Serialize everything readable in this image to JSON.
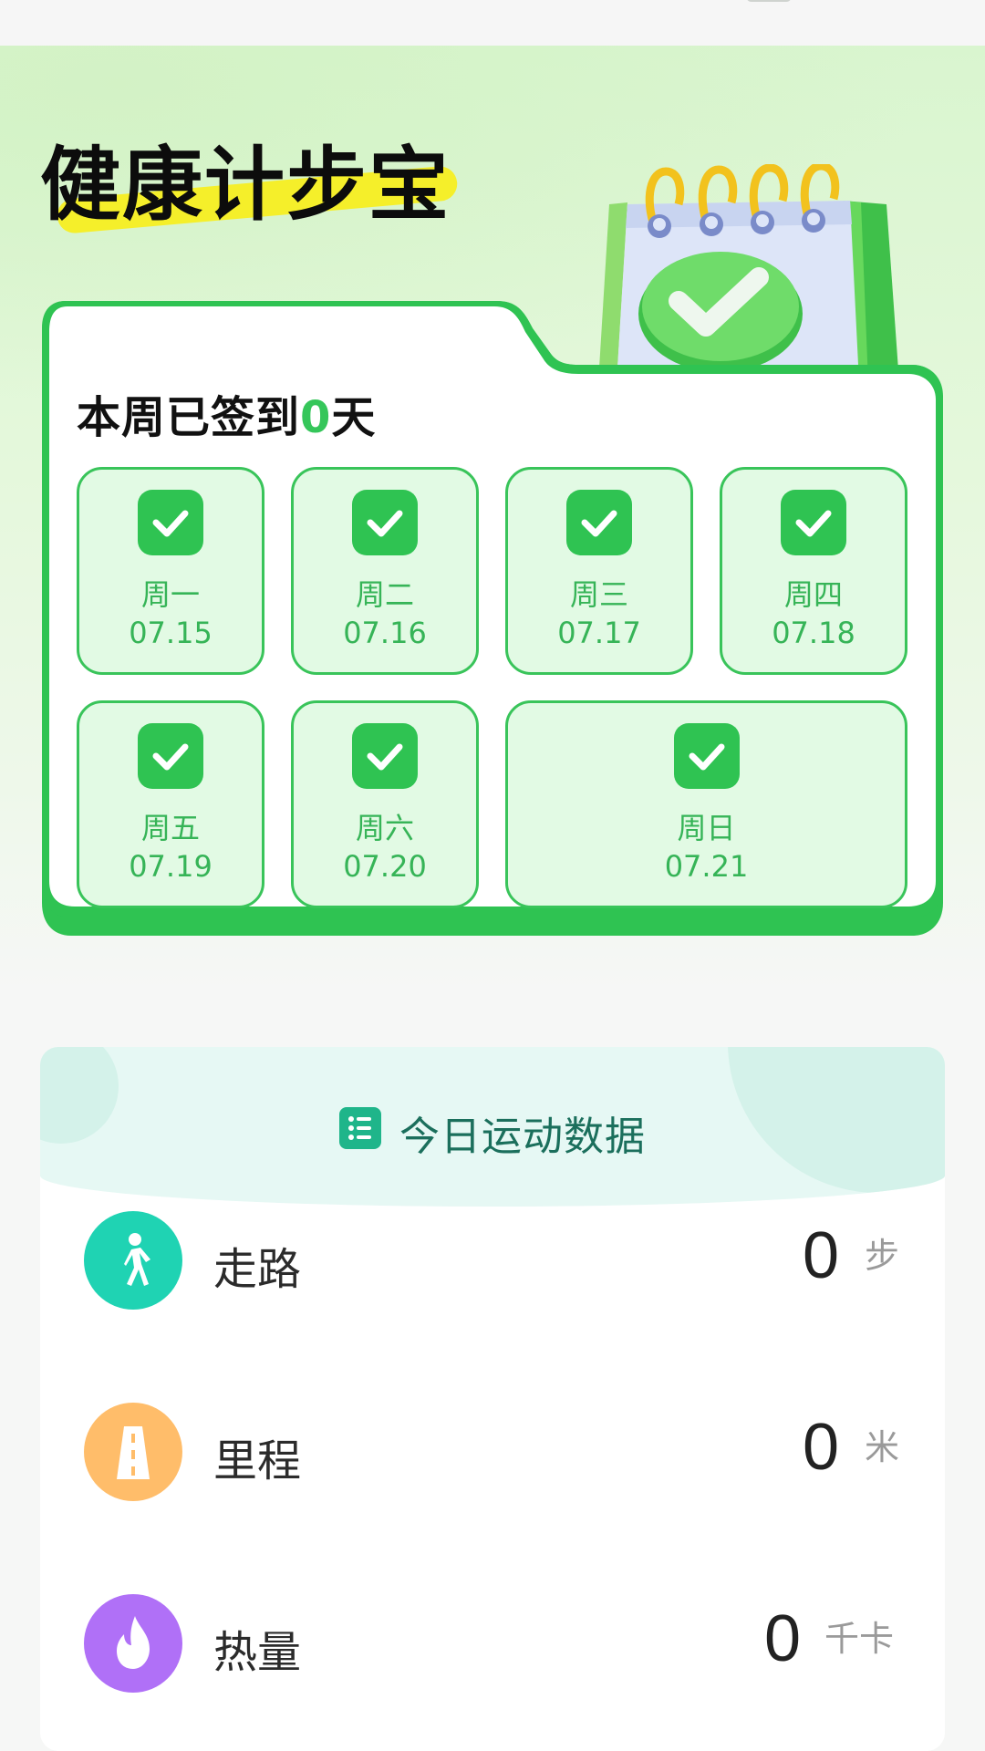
{
  "app": {
    "title": "健康计步宝"
  },
  "checkin": {
    "title_prefix": "本周已签到",
    "count": "0",
    "title_suffix": "天",
    "days": [
      {
        "name": "周一",
        "date": "07.15",
        "checked": true
      },
      {
        "name": "周二",
        "date": "07.16",
        "checked": true
      },
      {
        "name": "周三",
        "date": "07.17",
        "checked": true
      },
      {
        "name": "周四",
        "date": "07.18",
        "checked": true
      },
      {
        "name": "周五",
        "date": "07.19",
        "checked": true
      },
      {
        "name": "周六",
        "date": "07.20",
        "checked": true
      },
      {
        "name": "周日",
        "date": "07.21",
        "checked": true
      }
    ]
  },
  "today": {
    "title": "今日运动数据",
    "metrics": [
      {
        "label": "走路",
        "value": "0",
        "unit": "步",
        "icon": "walk-icon",
        "color": "#1fd3b3"
      },
      {
        "label": "里程",
        "value": "0",
        "unit": "米",
        "icon": "road-icon",
        "color": "#ffbd6a"
      },
      {
        "label": "热量",
        "value": "0",
        "unit": "千卡",
        "icon": "flame-icon",
        "color": "#b070f7"
      }
    ]
  },
  "colors": {
    "accent_green": "#35c65a",
    "card_bg": "#e2fae4",
    "teal_title": "#1b6f5c"
  }
}
